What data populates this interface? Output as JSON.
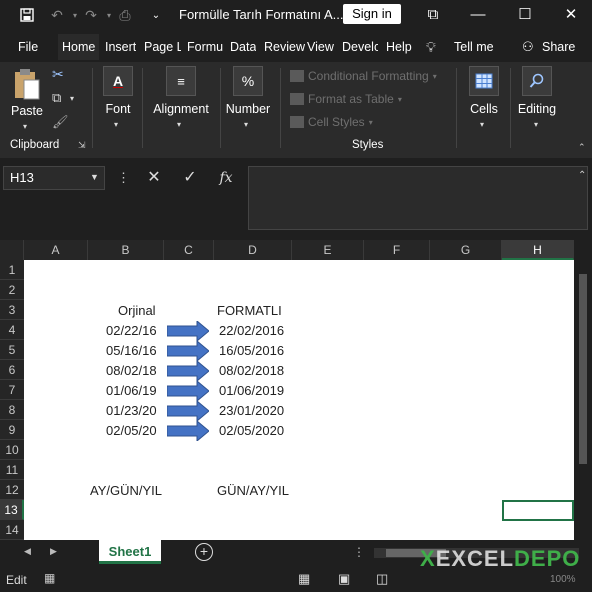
{
  "titlebar": {
    "title": "Formülle Tarıh Formatını A...",
    "signin": "Sign in"
  },
  "menu": [
    "File",
    "Home",
    "Insert",
    "Page L",
    "Formu",
    "Data",
    "Review",
    "View",
    "Develc",
    "Help",
    "Tell me",
    "Share"
  ],
  "ribbon": {
    "paste": "Paste",
    "clipboard": "Clipboard",
    "font": "Font",
    "alignment": "Alignment",
    "number": "Number",
    "number_icon": "%",
    "conditional": "Conditional Formatting",
    "format_table": "Format as Table",
    "cell_styles": "Cell Styles",
    "styles": "Styles",
    "cells": "Cells",
    "editing": "Editing"
  },
  "formula_bar": {
    "name_box": "H13",
    "fx": "fx",
    "value": ""
  },
  "columns": [
    "A",
    "B",
    "C",
    "D",
    "E",
    "F",
    "G",
    "H"
  ],
  "rows": [
    "1",
    "2",
    "3",
    "4",
    "5",
    "6",
    "7",
    "8",
    "9",
    "10",
    "11",
    "12",
    "13",
    "14"
  ],
  "selected_cell": "H13",
  "cells": {
    "b3": "Orjinal",
    "d3": "FORMATLI",
    "b_dates": [
      "02/22/16",
      "05/16/16",
      "08/02/18",
      "01/06/19",
      "01/23/20",
      "02/05/20"
    ],
    "d_dates": [
      "22/02/2016",
      "16/05/2016",
      "08/02/2018",
      "01/06/2019",
      "23/01/2020",
      "02/05/2020"
    ],
    "b12": "AY/GÜN/YIL",
    "d12": "GÜN/AY/YIL"
  },
  "arrow_color": "#4472c4",
  "sheet_tab": "Sheet1",
  "status": {
    "mode": "Edit",
    "zoom": "100%"
  },
  "logo": {
    "x": "X",
    "excel": "EXCEL",
    "depo": "DEPO"
  }
}
